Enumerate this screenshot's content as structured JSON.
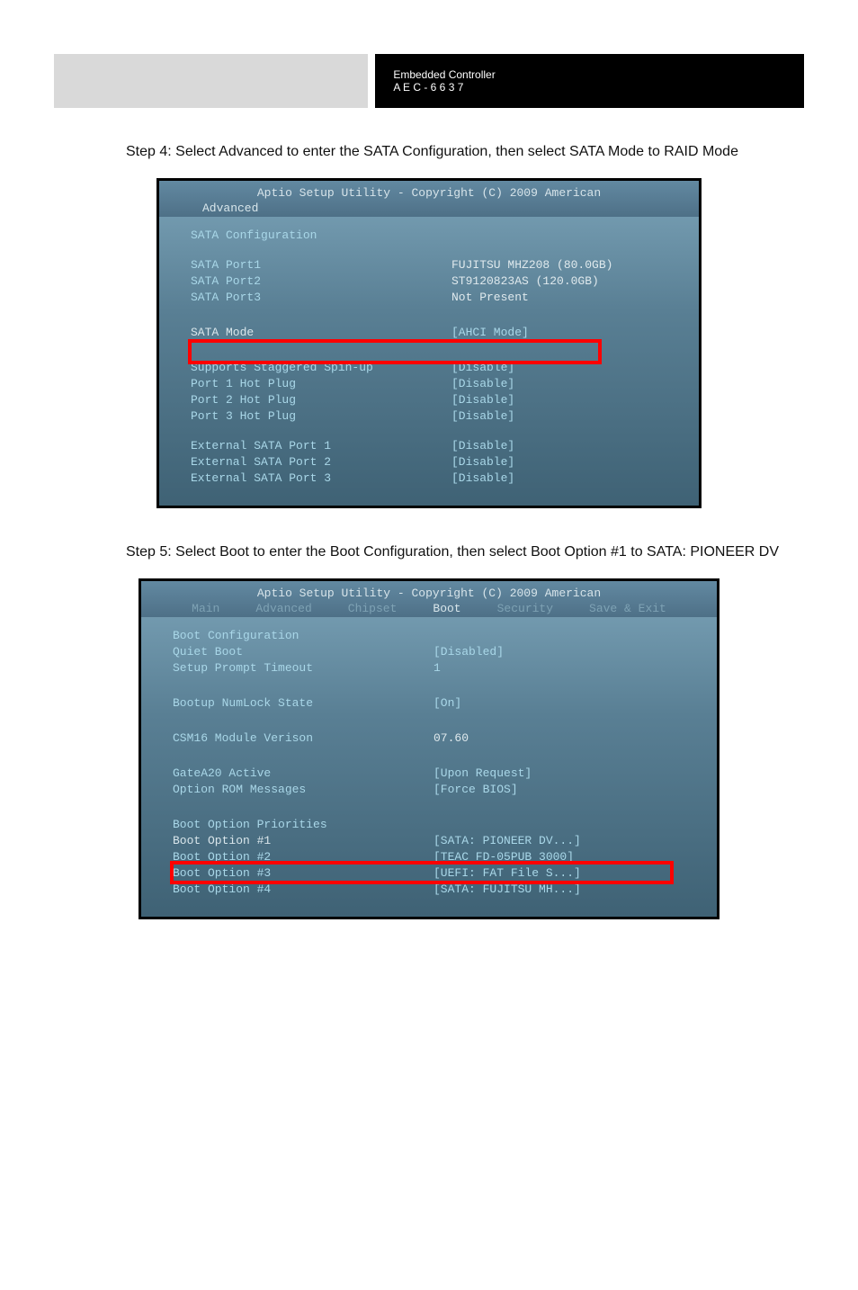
{
  "header": {
    "product": "Embedded Controller",
    "model_line": "A E C - 6 6 3 7"
  },
  "step1": {
    "text": "Step 4: Select Advanced to enter the SATA Configuration, then select SATA Mode to RAID Mode",
    "bios_title": "Aptio Setup Utility - Copyright (C) 2009 American",
    "tab": "Advanced",
    "section": "SATA Configuration",
    "rows": [
      {
        "l": "SATA Port1",
        "v": "FUJITSU MHZ208 (80.0GB)"
      },
      {
        "l": "SATA Port2",
        "v": "ST9120823AS   (120.0GB)"
      },
      {
        "l": "SATA Port3",
        "v": "Not Present"
      }
    ],
    "sata_mode_label": "SATA Mode",
    "sata_mode_value": "[AHCI Mode]",
    "rows2": [
      {
        "l": "Supports Staggered Spin-up",
        "v": "[Disable]"
      },
      {
        "l": "Port 1 Hot Plug",
        "v": "[Disable]"
      },
      {
        "l": "Port 2 Hot Plug",
        "v": "[Disable]"
      },
      {
        "l": "Port 3 Hot Plug",
        "v": "[Disable]"
      }
    ],
    "rows3": [
      {
        "l": "External SATA Port 1",
        "v": "[Disable]"
      },
      {
        "l": "External SATA Port 2",
        "v": "[Disable]"
      },
      {
        "l": "External SATA Port 3",
        "v": "[Disable]"
      }
    ]
  },
  "step2": {
    "text": "Step 5: Select Boot to enter the Boot Configuration, then select Boot Option #1 to SATA: PIONEER DV",
    "bios_title": "Aptio Setup Utility - Copyright (C) 2009 American",
    "tab": "Boot",
    "section": "Boot Configuration",
    "rows": [
      {
        "l": "Quiet Boot",
        "v": "[Disabled]"
      },
      {
        "l": "Setup Prompt Timeout",
        "v": "1"
      }
    ],
    "rows2": [
      {
        "l": "Bootup NumLock State",
        "v": "[On]"
      }
    ],
    "rows3": [
      {
        "l": "CSM16 Module Verison",
        "v": "07.60"
      }
    ],
    "rows4": [
      {
        "l": "GateA20 Active",
        "v": "[Upon Request]"
      },
      {
        "l": "Option ROM Messages",
        "v": "[Force BIOS]"
      }
    ],
    "prio_header": "Boot Option Priorities",
    "boot1_label": "Boot Option #1",
    "boot1_value": "[SATA: PIONEER DV...]",
    "boots": [
      {
        "l": "Boot Option #2",
        "v": "[TEAC FD-05PUB 3000]"
      },
      {
        "l": "Boot Option #3",
        "v": "[UEFI: FAT File S...]"
      },
      {
        "l": "Boot Option #4",
        "v": "[SATA: FUJITSU MH...]"
      }
    ]
  }
}
